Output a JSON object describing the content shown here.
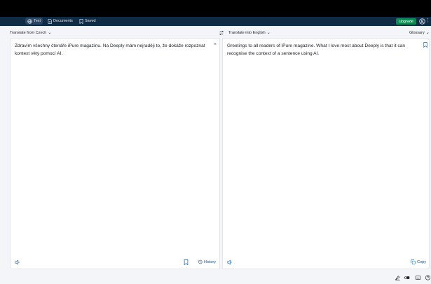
{
  "nav": {
    "tabs": [
      {
        "label": "Text",
        "icon": "globe-icon",
        "active": true
      },
      {
        "label": "Documents",
        "icon": "document-icon",
        "active": false
      },
      {
        "label": "Saved",
        "icon": "bookmark-icon",
        "active": false
      }
    ],
    "upgrade_label": "Upgrade",
    "user_icon": "user-icon"
  },
  "langbar": {
    "source_label": "Translate from Czech",
    "target_label": "Translate into English",
    "glossary_label": "Glossary"
  },
  "source": {
    "text": "Zdravím všechny čtenáře iPure magazínu. Na Deeply mám nejraději to, že dokáže rozpoznat kontext věty pomocí AI.",
    "history_label": "History"
  },
  "target": {
    "text": "Greetings to all readers of iPure magazine. What I love most about Deeply is that it can recognise the context of a sentence using AI.",
    "copy_label": "Copy"
  },
  "colors": {
    "nav_bg": "#0f2b46",
    "accent_green": "#0b8a53",
    "link_blue": "#0f4a8a"
  }
}
